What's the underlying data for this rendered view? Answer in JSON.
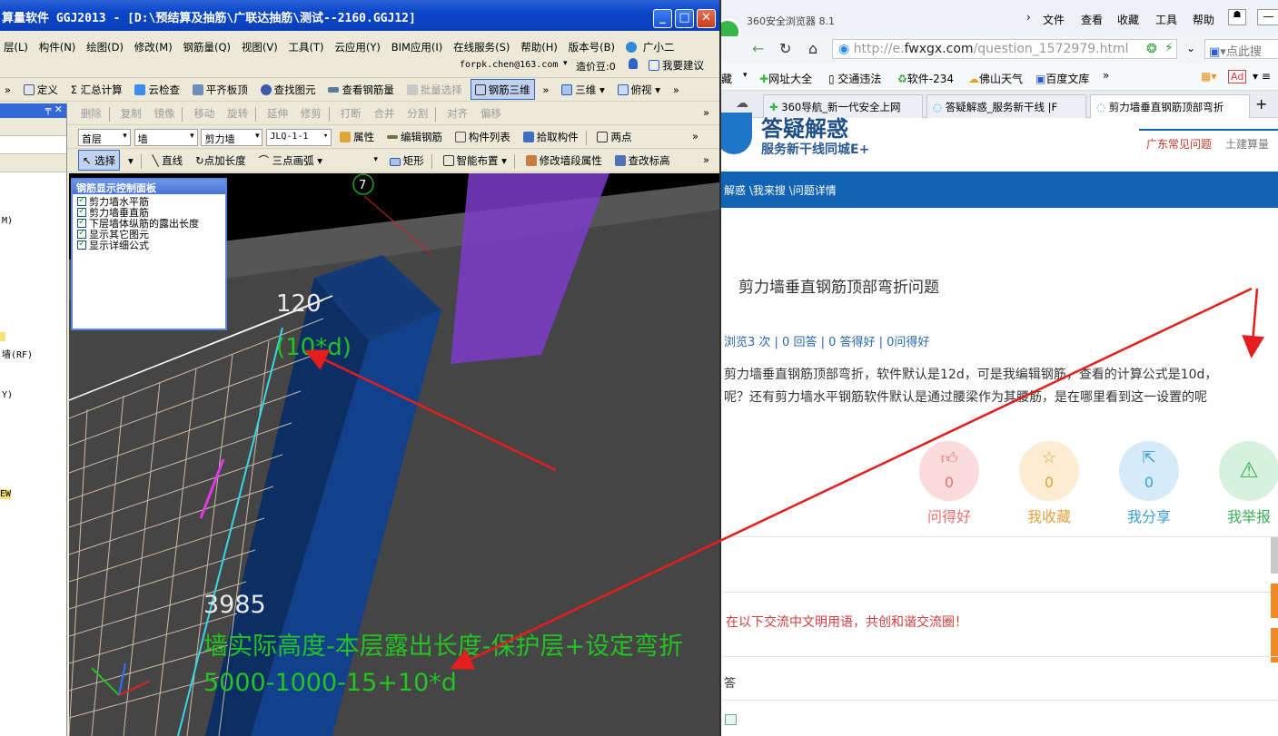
{
  "app": {
    "title": "算量软件 GGJ2013 - [D:\\预结算及抽筋\\广联达抽筋\\测试--2160.GGJ12]",
    "window_buttons": {
      "minimize": "_",
      "maximize": "□",
      "close": "✕"
    },
    "menu": [
      "层(L)",
      "构件(N)",
      "绘图(D)",
      "修改(M)",
      "钢筋量(Q)",
      "视图(V)",
      "工具(T)",
      "云应用(Y)",
      "BIM应用(I)",
      "在线服务(S)",
      "帮助(H)",
      "版本号(B)",
      "广小二"
    ],
    "account": {
      "email": "forpk.chen@163.com",
      "beans": "造价豆:0",
      "feedback": "我要建议"
    },
    "toolbar1": [
      "定义",
      "Σ 汇总计算",
      "云检查",
      "平齐板顶",
      "查找图元",
      "查看钢筋量",
      "批量选择",
      "钢筋三维",
      "三维",
      "俯视"
    ],
    "toolbar2": [
      "删除",
      "复制",
      "镜像",
      "移动",
      "旋转",
      "延伸",
      "修剪",
      "打断",
      "合并",
      "分割",
      "对齐",
      "偏移"
    ],
    "toolbar3": {
      "floor": "首层",
      "category": "墙",
      "type": "剪力墙",
      "element": "JLQ-1-1",
      "buttons": [
        "属性",
        "编辑钢筋",
        "构件列表",
        "拾取构件",
        "两点"
      ]
    },
    "toolbar4": [
      "选择",
      "直线",
      "点加长度",
      "三点画弧",
      "矩形",
      "智能布置",
      "修改墙段属性",
      "查改标高"
    ],
    "left_panel": {
      "pin": "╤ ✕",
      "items": [
        "M)",
        "墙(RF)",
        "Y)",
        "EW"
      ]
    },
    "rebar_panel": {
      "title": "钢筋显示控制面板",
      "options": [
        "剪力墙水平筋",
        "剪力墙垂直筋",
        "下层墙体纵筋的露出长度",
        "显示其它图元",
        "显示详细公式"
      ]
    },
    "viewport": {
      "axis_label": "7",
      "dim_top": "120",
      "dim_formula": "(10*d)",
      "dim_left": "3985",
      "formula_text": "墙实际高度-本层露出长度-保护层+设定弯折",
      "formula_values": "5000-1000-15+10*d"
    }
  },
  "browser": {
    "title": "360安全浏览器 8.1",
    "menu": [
      "文件",
      "查看",
      "收藏",
      "工具",
      "帮助"
    ],
    "url_prefix": "http://e.",
    "url_domain": "fwxgx.com",
    "url_path": "/question_1572979.html",
    "search_placeholder": "点此搜",
    "bookmarks": [
      "藏",
      "网址大全",
      "交通违法",
      "软件-234",
      "佛山天气",
      "百度文库"
    ],
    "tabs": [
      "360导航_新一代安全上网",
      "答疑解惑_服务新干线 |F",
      "剪力墙垂直钢筋顶部弯折"
    ],
    "site": {
      "logo_title": "答疑解惑",
      "logo_subtitle": "服务新干线同城E+",
      "nav_right": [
        "广东常见问题",
        "土建算量"
      ],
      "breadcrumb": "解惑 \\我来搜 \\问题详情",
      "question_title": "剪力墙垂直钢筋顶部弯折问题",
      "question_stats": "浏览3 次 | 0 回答 | 0 答得好 | 0问得好",
      "question_body_1": "剪力墙垂直钢筋顶部弯折，软件默认是12d，可是我编辑钢筋，查看的计算公式是10d，",
      "question_body_2": "呢？还有剪力墙水平钢筋软件默认是通过腰梁作为其腰筋，是在哪里看到这一设置的呢",
      "stats": [
        {
          "label": "问得好",
          "value": "0",
          "icon": "thumbs-up",
          "color": "#e8716e",
          "bg": "#fbdcdc"
        },
        {
          "label": "我收藏",
          "value": "0",
          "icon": "star",
          "color": "#e2a23d",
          "bg": "#fcecd2"
        },
        {
          "label": "我分享",
          "value": "0",
          "icon": "share",
          "color": "#3a9ed8",
          "bg": "#d5ebf8"
        },
        {
          "label": "我举报",
          "value": "",
          "icon": "warning",
          "color": "#3dae58",
          "bg": "#d6f1dc"
        }
      ],
      "notice": "在以下交流中文明用语，共创和谐交流圈！",
      "answer_label": "答"
    }
  }
}
